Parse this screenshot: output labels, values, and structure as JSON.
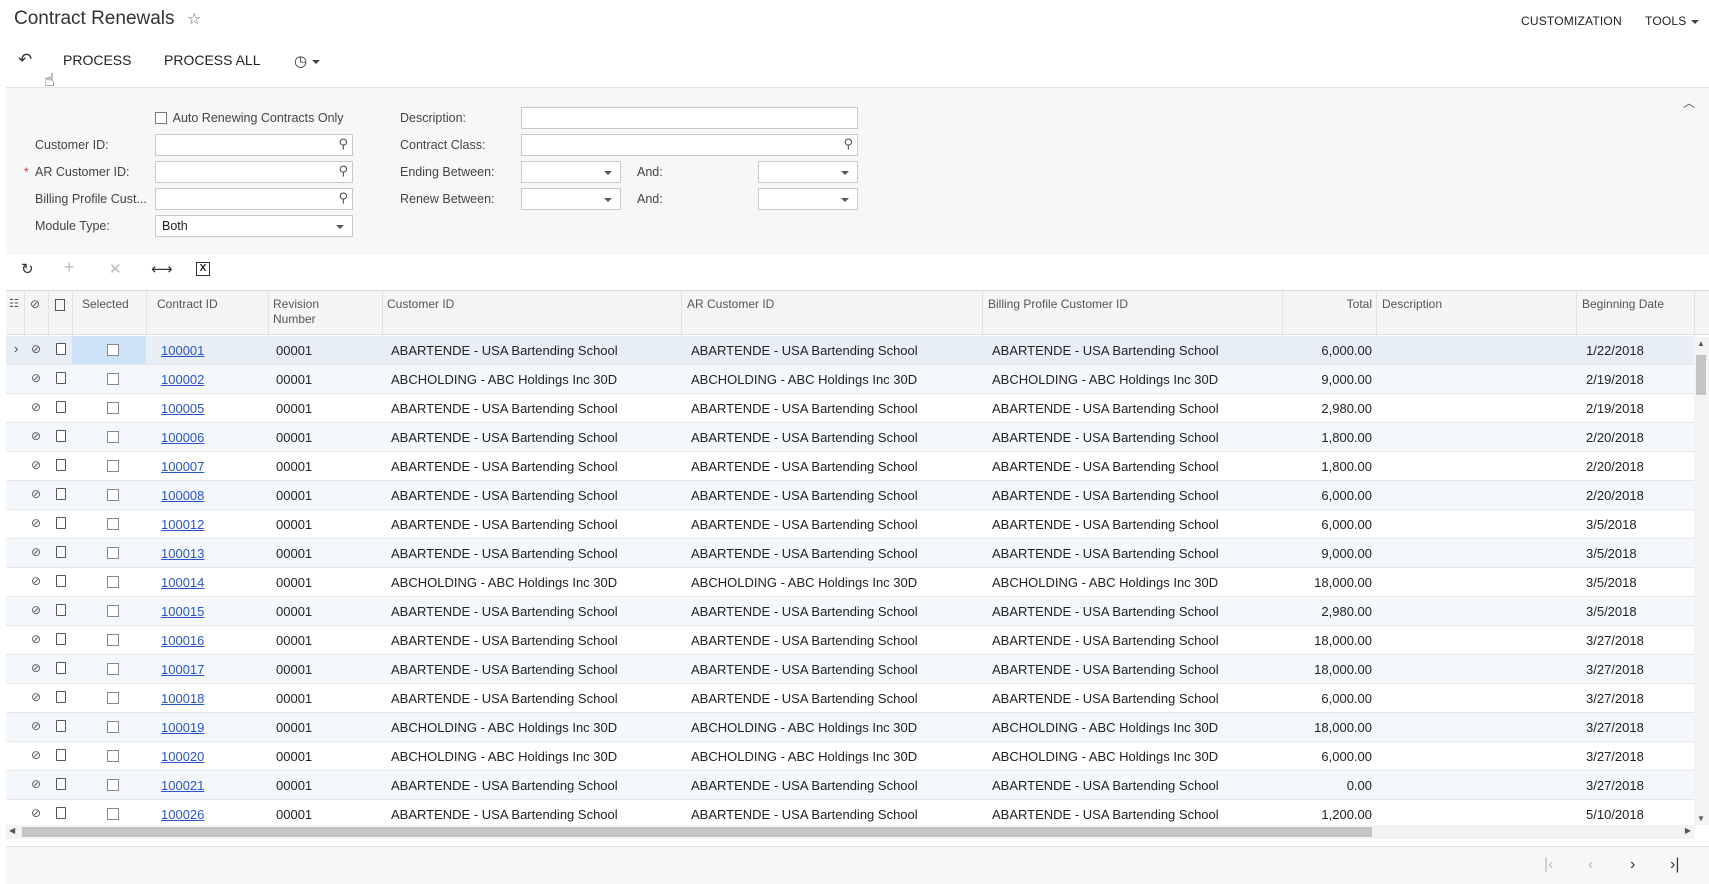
{
  "header": {
    "title": "Contract Renewals",
    "customization": "CUSTOMIZATION",
    "tools": "TOOLS"
  },
  "toolbar": {
    "process": "PROCESS",
    "process_all": "PROCESS ALL"
  },
  "filters": {
    "auto_renewing_label": "Auto Renewing Contracts Only",
    "customer_id_label": "Customer ID:",
    "ar_customer_id_label": "AR Customer ID:",
    "billing_profile_label": "Billing Profile Cust...",
    "module_type_label": "Module Type:",
    "module_type_value": "Both",
    "description_label": "Description:",
    "contract_class_label": "Contract Class:",
    "ending_between_label": "Ending Between:",
    "renew_between_label": "Renew Between:",
    "and_label": "And:"
  },
  "grid": {
    "headers": {
      "selected": "Selected",
      "contract_id": "Contract ID",
      "revision_number": "Revision Number",
      "customer_id": "Customer ID",
      "ar_customer_id": "AR Customer ID",
      "billing_profile_customer_id": "Billing Profile Customer ID",
      "total": "Total",
      "description": "Description",
      "beginning_date": "Beginning Date"
    },
    "rows": [
      {
        "contract_id": "100001",
        "revision": "00001",
        "customer": "ABARTENDE - USA Bartending School",
        "ar_customer": "ABARTENDE - USA Bartending School",
        "billing": "ABARTENDE - USA Bartending School",
        "total": "6,000.00",
        "date": "1/22/2018"
      },
      {
        "contract_id": "100002",
        "revision": "00001",
        "customer": "ABCHOLDING - ABC Holdings Inc 30D",
        "ar_customer": "ABCHOLDING - ABC Holdings Inc 30D",
        "billing": "ABCHOLDING - ABC Holdings Inc 30D",
        "total": "9,000.00",
        "date": "2/19/2018"
      },
      {
        "contract_id": "100005",
        "revision": "00001",
        "customer": "ABARTENDE - USA Bartending School",
        "ar_customer": "ABARTENDE - USA Bartending School",
        "billing": "ABARTENDE - USA Bartending School",
        "total": "2,980.00",
        "date": "2/19/2018"
      },
      {
        "contract_id": "100006",
        "revision": "00001",
        "customer": "ABARTENDE - USA Bartending School",
        "ar_customer": "ABARTENDE - USA Bartending School",
        "billing": "ABARTENDE - USA Bartending School",
        "total": "1,800.00",
        "date": "2/20/2018"
      },
      {
        "contract_id": "100007",
        "revision": "00001",
        "customer": "ABARTENDE - USA Bartending School",
        "ar_customer": "ABARTENDE - USA Bartending School",
        "billing": "ABARTENDE - USA Bartending School",
        "total": "1,800.00",
        "date": "2/20/2018"
      },
      {
        "contract_id": "100008",
        "revision": "00001",
        "customer": "ABARTENDE - USA Bartending School",
        "ar_customer": "ABARTENDE - USA Bartending School",
        "billing": "ABARTENDE - USA Bartending School",
        "total": "6,000.00",
        "date": "2/20/2018"
      },
      {
        "contract_id": "100012",
        "revision": "00001",
        "customer": "ABARTENDE - USA Bartending School",
        "ar_customer": "ABARTENDE - USA Bartending School",
        "billing": "ABARTENDE - USA Bartending School",
        "total": "6,000.00",
        "date": "3/5/2018"
      },
      {
        "contract_id": "100013",
        "revision": "00001",
        "customer": "ABARTENDE - USA Bartending School",
        "ar_customer": "ABARTENDE - USA Bartending School",
        "billing": "ABARTENDE - USA Bartending School",
        "total": "9,000.00",
        "date": "3/5/2018"
      },
      {
        "contract_id": "100014",
        "revision": "00001",
        "customer": "ABCHOLDING - ABC Holdings Inc 30D",
        "ar_customer": "ABCHOLDING - ABC Holdings Inc 30D",
        "billing": "ABCHOLDING - ABC Holdings Inc 30D",
        "total": "18,000.00",
        "date": "3/5/2018"
      },
      {
        "contract_id": "100015",
        "revision": "00001",
        "customer": "ABARTENDE - USA Bartending School",
        "ar_customer": "ABARTENDE - USA Bartending School",
        "billing": "ABARTENDE - USA Bartending School",
        "total": "2,980.00",
        "date": "3/5/2018"
      },
      {
        "contract_id": "100016",
        "revision": "00001",
        "customer": "ABARTENDE - USA Bartending School",
        "ar_customer": "ABARTENDE - USA Bartending School",
        "billing": "ABARTENDE - USA Bartending School",
        "total": "18,000.00",
        "date": "3/27/2018"
      },
      {
        "contract_id": "100017",
        "revision": "00001",
        "customer": "ABARTENDE - USA Bartending School",
        "ar_customer": "ABARTENDE - USA Bartending School",
        "billing": "ABARTENDE - USA Bartending School",
        "total": "18,000.00",
        "date": "3/27/2018"
      },
      {
        "contract_id": "100018",
        "revision": "00001",
        "customer": "ABARTENDE - USA Bartending School",
        "ar_customer": "ABARTENDE - USA Bartending School",
        "billing": "ABARTENDE - USA Bartending School",
        "total": "6,000.00",
        "date": "3/27/2018"
      },
      {
        "contract_id": "100019",
        "revision": "00001",
        "customer": "ABCHOLDING - ABC Holdings Inc 30D",
        "ar_customer": "ABCHOLDING - ABC Holdings Inc 30D",
        "billing": "ABCHOLDING - ABC Holdings Inc 30D",
        "total": "18,000.00",
        "date": "3/27/2018"
      },
      {
        "contract_id": "100020",
        "revision": "00001",
        "customer": "ABCHOLDING - ABC Holdings Inc 30D",
        "ar_customer": "ABCHOLDING - ABC Holdings Inc 30D",
        "billing": "ABCHOLDING - ABC Holdings Inc 30D",
        "total": "6,000.00",
        "date": "3/27/2018"
      },
      {
        "contract_id": "100021",
        "revision": "00001",
        "customer": "ABARTENDE - USA Bartending School",
        "ar_customer": "ABARTENDE - USA Bartending School",
        "billing": "ABARTENDE - USA Bartending School",
        "total": "0.00",
        "date": "3/27/2018"
      },
      {
        "contract_id": "100026",
        "revision": "00001",
        "customer": "ABARTENDE - USA Bartending School",
        "ar_customer": "ABARTENDE - USA Bartending School",
        "billing": "ABARTENDE - USA Bartending School",
        "total": "1,200.00",
        "date": "5/10/2018"
      }
    ]
  },
  "colors": {
    "link": "#2a55c8",
    "selected_row": "#e8eef5",
    "selected_cell": "#cfe3f6"
  }
}
